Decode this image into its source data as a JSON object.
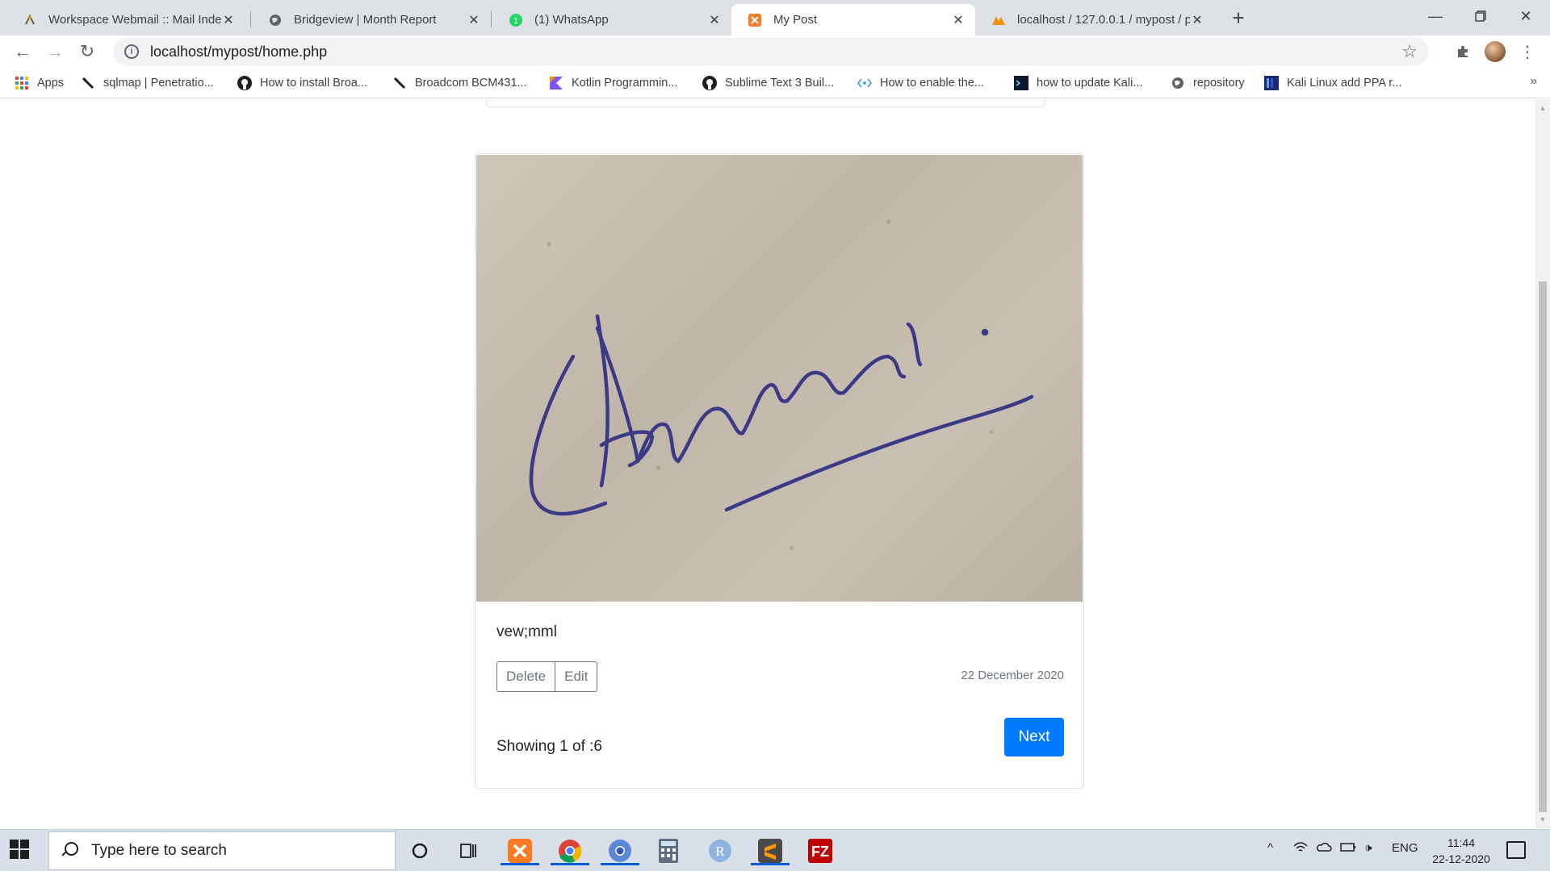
{
  "browser": {
    "tabs": [
      {
        "title": "Workspace Webmail :: Mail Index",
        "icon": "webmail-icon",
        "active": false
      },
      {
        "title": "Bridgeview | Month Report",
        "icon": "globe-icon",
        "active": false
      },
      {
        "title": "(1) WhatsApp",
        "icon": "whatsapp-icon",
        "active": false
      },
      {
        "title": "My Post",
        "icon": "xampp-icon",
        "active": true
      },
      {
        "title": "localhost / 127.0.0.1 / mypost / p",
        "icon": "phpmyadmin-icon",
        "active": false
      }
    ],
    "address": "localhost/mypost/home.php",
    "bookmarks": [
      {
        "label": "Apps",
        "icon": "apps-grid-icon"
      },
      {
        "label": "sqlmap | Penetratio...",
        "icon": "sqlmap-icon"
      },
      {
        "label": "How to install Broa...",
        "icon": "github-icon"
      },
      {
        "label": "Broadcom BCM431...",
        "icon": "sqlmap-icon"
      },
      {
        "label": "Kotlin Programmin...",
        "icon": "kotlin-icon"
      },
      {
        "label": "Sublime Text 3 Buil...",
        "icon": "github-icon"
      },
      {
        "label": "How to enable the...",
        "icon": "code-icon"
      },
      {
        "label": "how to update Kali...",
        "icon": "terminal-icon"
      },
      {
        "label": "repository",
        "icon": "globe-icon"
      },
      {
        "label": "Kali Linux add PPA r...",
        "icon": "kali-icon"
      }
    ]
  },
  "post": {
    "image_alt": "signature image",
    "text": "vew;mml",
    "delete_label": "Delete",
    "edit_label": "Edit",
    "date": "22 December 2020",
    "next_label": "Next",
    "showing": "Showing 1 of :6"
  },
  "taskbar": {
    "search_placeholder": "Type here to search",
    "apps": [
      "cortana-icon",
      "task-view-icon",
      "xampp-icon",
      "chrome-icon",
      "chromium-icon",
      "calculator-icon",
      "r-icon",
      "sublime-icon",
      "filezilla-icon"
    ],
    "tray_language": "ENG",
    "time": "11:44",
    "date": "22-12-2020"
  },
  "colors": {
    "primary": "#007bff",
    "secondary": "#6c757d",
    "tabstrip": "#dee1e6"
  }
}
